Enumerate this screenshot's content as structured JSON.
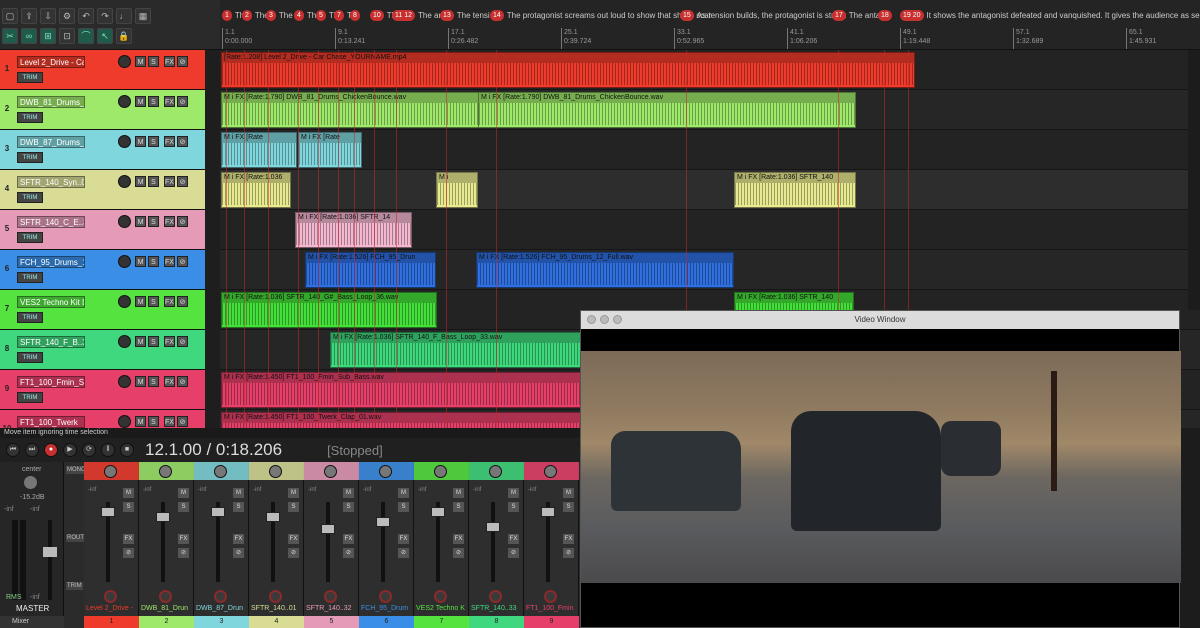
{
  "status_text": "Move item ignoring time selection",
  "transport": {
    "time": "12.1.00 / 0:18.206",
    "state": "[Stopped]"
  },
  "markers": [
    {
      "n": "1",
      "t": "Thi"
    },
    {
      "n": "2",
      "t": "The"
    },
    {
      "n": "3",
      "t": "The"
    },
    {
      "n": "4",
      "t": "The"
    },
    {
      "n": "5",
      "t": "Th"
    },
    {
      "n": "7",
      "t": "Th"
    },
    {
      "n": "8",
      "t": ""
    },
    {
      "n": "10",
      "t": "The"
    },
    {
      "n": "11 12",
      "t": "The ant"
    },
    {
      "n": "13",
      "t": "The tensi"
    },
    {
      "n": "14",
      "t": "The protagonist screams out loud to show that she is scar"
    },
    {
      "n": "15",
      "t": "As tension builds, the protagonist is struck"
    },
    {
      "n": "17",
      "t": "The antag"
    },
    {
      "n": "18",
      "t": ""
    },
    {
      "n": "19 20",
      "t": "It shows the antagonist defeated and vanquished. It gives the audience as sense of triun"
    }
  ],
  "ruler": [
    {
      "bar": "1.1",
      "time": "0:00.000"
    },
    {
      "bar": "9.1",
      "time": "0:13.241"
    },
    {
      "bar": "17.1",
      "time": "0:26.482"
    },
    {
      "bar": "25.1",
      "time": "0:39.724"
    },
    {
      "bar": "33.1",
      "time": "0:52.965"
    },
    {
      "bar": "41.1",
      "time": "1:06.206"
    },
    {
      "bar": "49.1",
      "time": "1:19.448"
    },
    {
      "bar": "57.1",
      "time": "1:32.689"
    },
    {
      "bar": "65.1",
      "time": "1:45.931"
    }
  ],
  "tracks": [
    {
      "num": "1",
      "name": "Level 2_Drive - Car",
      "color": "#ee3b2b"
    },
    {
      "num": "2",
      "name": "DWB_81_Drums_C",
      "color": "#9ee86a"
    },
    {
      "num": "3",
      "name": "DWB_87_Drums_C",
      "color": "#7fd6dc"
    },
    {
      "num": "4",
      "name": "SFTR_140_Syn..01",
      "color": "#d8dc95"
    },
    {
      "num": "5",
      "name": "SFTR_140_C_E..32",
      "color": "#e59ab8"
    },
    {
      "num": "6",
      "name": "FCH_95_Drums_1",
      "color": "#3a8ee6"
    },
    {
      "num": "7",
      "name": "VES2 Techno Kit Dr",
      "color": "#55e340"
    },
    {
      "num": "8",
      "name": "SFTR_140_F_B..33",
      "color": "#40d87e"
    },
    {
      "num": "9",
      "name": "FT1_100_Fmin_Sub",
      "color": "#e6406a"
    },
    {
      "num": "10",
      "name": "FT1_100_Twerk",
      "color": "#e6406a"
    }
  ],
  "items": [
    {
      "lane": 0,
      "label": "[Rate:1.208] Level 2_Drive - Car Chase_YOURNAME.mp4",
      "color": "#ee3b2b"
    },
    {
      "lane": 1,
      "label": "M i FX [Rate:1.790] DWB_81_Drums_ChickenBounce.wav",
      "color": "#9ee86a"
    },
    {
      "lane": 1,
      "label": "M i FX [Rate:1.790] DWB_81_Drums_ChickenBounce.wav",
      "color": "#9ee86a"
    },
    {
      "lane": 2,
      "label": "M i FX [Rate",
      "color": "#7fd6dc"
    },
    {
      "lane": 2,
      "label": "M i FX [Rate",
      "color": "#7fd6dc"
    },
    {
      "lane": 3,
      "label": "M i FX [Rate:1.036",
      "color": "#e7ea8e"
    },
    {
      "lane": 3,
      "label": "M i",
      "color": "#e7ea8e"
    },
    {
      "lane": 3,
      "label": "M i FX [Rate:1.036] SFTR_140",
      "color": "#e7ea8e"
    },
    {
      "lane": 4,
      "label": "M i FX [Rate:1.036] SFTR_14",
      "color": "#f3b7d0"
    },
    {
      "lane": 5,
      "label": "M i FX [Rate:1.526] FCH_95_Drun",
      "color": "#2f6fe0"
    },
    {
      "lane": 5,
      "label": "M i FX [Rate:1.526] FCH_95_Drums_12_Full.wav",
      "color": "#2f6fe0"
    },
    {
      "lane": 6,
      "label": "M i FX [Rate:1.036] SFTR_140_G#_Bass_Loop_36.wav",
      "color": "#44e03a"
    },
    {
      "lane": 6,
      "label": "M i FX [Rate:1.036] SFTR_140",
      "color": "#44e03a"
    },
    {
      "lane": 7,
      "label": "M i FX [Rate:1.036] SFTR_140_F_Bass_Loop_33.wav",
      "color": "#3ed87c"
    },
    {
      "lane": 8,
      "label": "M i FX [Rate:1.450] FT1_100_Fmin_Sub_Bass.wav",
      "color": "#e6406a"
    },
    {
      "lane": 9,
      "label": "M i FX [Rate:1.450] FT1_100_Twerk_Clap_01.wav",
      "color": "#e6406a"
    }
  ],
  "mixer": {
    "master": {
      "label": "MASTER",
      "db": "-15.2dB",
      "rms": "RMS",
      "inf": "-inf",
      "center": "center"
    },
    "strips": [
      {
        "name": "Level 2_Drive -",
        "num": "1",
        "color": "#ee3b2b"
      },
      {
        "name": "DWB_81_Drun",
        "num": "2",
        "color": "#9ee86a"
      },
      {
        "name": "DWB_87_Drun",
        "num": "3",
        "color": "#7fd6dc"
      },
      {
        "name": "SFTR_140..01",
        "num": "4",
        "color": "#d8dc95"
      },
      {
        "name": "SFTR_140..32",
        "num": "5",
        "color": "#e59ab8"
      },
      {
        "name": "FCH_95_Drum",
        "num": "6",
        "color": "#3a8ee6"
      },
      {
        "name": "VES2 Techno K",
        "num": "7",
        "color": "#55e340"
      },
      {
        "name": "SFTR_140..33",
        "num": "8",
        "color": "#40d87e"
      },
      {
        "name": "FT1_100_Fmin",
        "num": "9",
        "color": "#e6406a"
      }
    ],
    "inf": "-inf",
    "mono": "MONO",
    "route": "ROUTE",
    "trim": "TRIM",
    "tab": "Mixer"
  },
  "video": {
    "title": "Video Window"
  }
}
